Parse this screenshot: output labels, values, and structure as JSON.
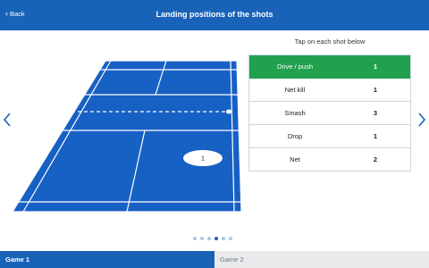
{
  "header": {
    "back_label": "Back",
    "title": "Landing positions of the shots"
  },
  "court": {
    "marker_label": "1",
    "court_color": "#1760c4",
    "line_color": "#ffffff"
  },
  "shots": {
    "header": "Tap on each shot below",
    "items": [
      {
        "name": "Drive / push",
        "count": "1",
        "selected": true
      },
      {
        "name": "Net kill",
        "count": "1",
        "selected": false
      },
      {
        "name": "Smash",
        "count": "3",
        "selected": false
      },
      {
        "name": "Drop",
        "count": "1",
        "selected": false
      },
      {
        "name": "Net",
        "count": "2",
        "selected": false
      }
    ]
  },
  "pager": {
    "page_count": 6,
    "current_page": 4
  },
  "tabs": [
    {
      "label": "Game 1",
      "selected": true
    },
    {
      "label": "Game 2",
      "selected": false
    }
  ],
  "colors": {
    "accent": "#1862b8",
    "selected_row": "#21a04e"
  },
  "icons": {
    "back": "chevron-left-icon",
    "prev": "chevron-left-icon",
    "next": "chevron-right-icon"
  }
}
